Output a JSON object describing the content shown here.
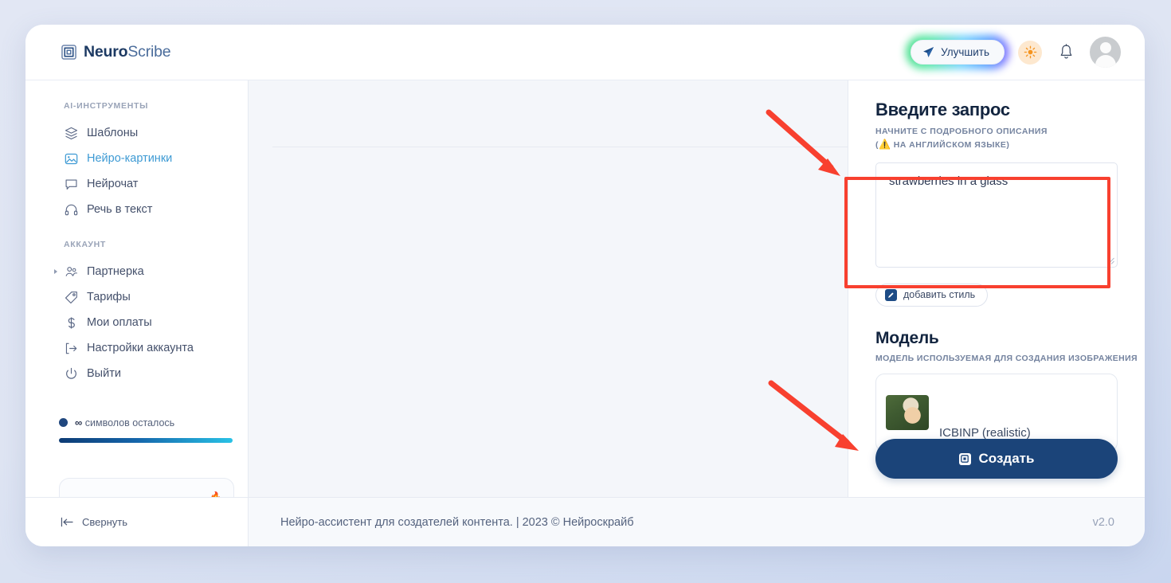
{
  "header": {
    "brand_bold": "Neuro",
    "brand_light": "Scribe",
    "logo_icon": "nested-square-logo-icon",
    "upgrade_label": "Улучшить",
    "upgrade_icon": "rocket-icon",
    "theme_icon": "sun-icon",
    "notifications_icon": "bell-icon",
    "avatar_icon": "user-avatar-icon"
  },
  "sidebar": {
    "group_tools_title": "AI-ИНСТРУМЕНТЫ",
    "tools": [
      {
        "label": "Шаблоны",
        "icon": "layers-icon",
        "active": false
      },
      {
        "label": "Нейро-картинки",
        "icon": "image-icon",
        "active": true
      },
      {
        "label": "Нейрочат",
        "icon": "chat-bubble-icon",
        "active": false
      },
      {
        "label": "Речь в текст",
        "icon": "headphones-icon",
        "active": false
      }
    ],
    "group_account_title": "АККАУНТ",
    "account": [
      {
        "label": "Партнерка",
        "icon": "users-icon",
        "expandable": true
      },
      {
        "label": "Тарифы",
        "icon": "tag-icon",
        "expandable": false
      },
      {
        "label": "Мои оплаты",
        "icon": "dollar-icon",
        "expandable": false
      },
      {
        "label": "Настройки аккаунта",
        "icon": "account-settings-icon",
        "expandable": false
      },
      {
        "label": "Выйти",
        "icon": "power-icon",
        "expandable": false
      }
    ],
    "quota_symbol": "∞",
    "quota_label": "символов осталось",
    "quota_progress_percent": 100,
    "collapse_label": "Свернуть",
    "collapse_icon": "collapse-left-icon"
  },
  "right_panel": {
    "prompt_title": "Введите запрос",
    "prompt_subtitle_line1": "НАЧНИТЕ С ПОДРОБНОГО ОПИСАНИЯ",
    "prompt_subtitle_line2_pre": "(",
    "prompt_subtitle_warn_icon": "⚠️",
    "prompt_subtitle_line2": " НА АНГЛИЙСКОМ ЯЗЫКЕ)",
    "prompt_value": "strawberries in a glass",
    "prompt_placeholder": "",
    "add_style_label": "добавить стиль",
    "add_style_icon": "pencil-icon",
    "model_title": "Модель",
    "model_subtitle": "МОДЕЛЬ ИСПОЛЬЗУЕМАЯ ДЛЯ СОЗДАНИЯ ИЗОБРАЖЕНИЯ",
    "model_name": "ICBINP (realistic)",
    "model_thumbnail": "model-preview-thumbnail",
    "create_label": "Создать",
    "create_icon": "image-plus-icon"
  },
  "footer": {
    "text": "Нейро-ассистент для создателей контента.  | 2023 © Нейроскрайб",
    "version": "v2.0"
  },
  "colors": {
    "accent_dark_blue": "#1b4479",
    "active_blue": "#3d9ad4",
    "annotation_red": "#f8402f",
    "canvas_bg": "#f4f6fa",
    "page_bg": "#dfe5f3"
  }
}
